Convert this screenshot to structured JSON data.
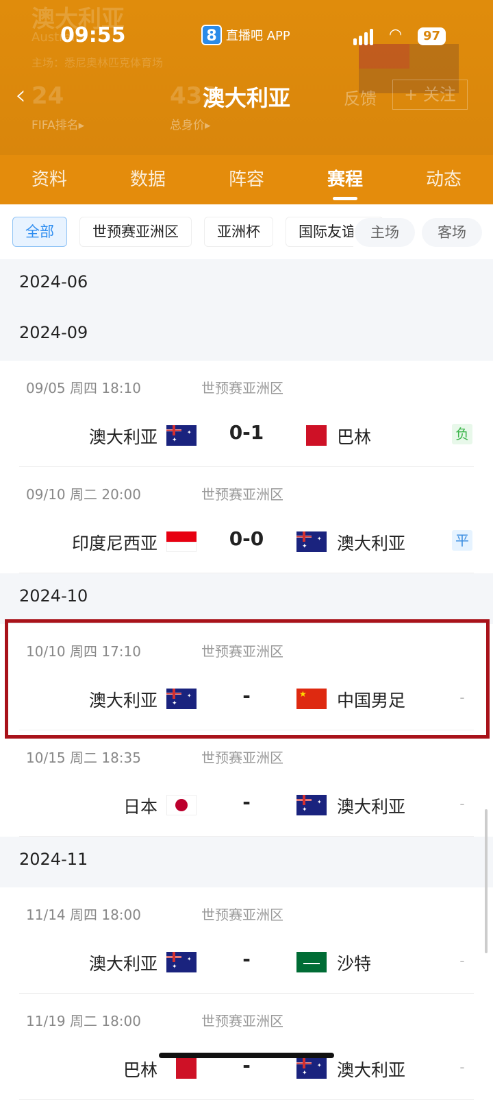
{
  "status_bar": {
    "time": "09:55",
    "app_name": "直播吧 APP",
    "app_logo": "8",
    "battery": "97"
  },
  "header_bg": {
    "team_name": "澳大利亚",
    "team_name_en": "Australia",
    "home_stadium": "主场：悉尼奥林匹克体育场",
    "fifa_rank": "24",
    "fifa_rank_label": "FIFA排名▸",
    "total_value": "432",
    "total_value_label": "总身价▸"
  },
  "nav": {
    "title": "澳大利亚",
    "feedback": "反馈",
    "follow": "+ 关注"
  },
  "tabs": [
    {
      "label": "资料"
    },
    {
      "label": "数据"
    },
    {
      "label": "阵容"
    },
    {
      "label": "赛程",
      "active": true
    },
    {
      "label": "动态"
    }
  ],
  "filters": [
    {
      "label": "全部",
      "active": true
    },
    {
      "label": "世预赛亚洲区"
    },
    {
      "label": "亚洲杯"
    },
    {
      "label": "国际友谊赛"
    }
  ],
  "venue_filters": [
    {
      "label": "主场"
    },
    {
      "label": "客场"
    }
  ],
  "months": [
    "2024-06",
    "2024-09",
    "2024-10",
    "2024-11"
  ],
  "matches": [
    {
      "date": "09/05  周四 18:10",
      "competition": "世预赛亚洲区",
      "home": "澳大利亚",
      "away": "巴林",
      "score": "0-1",
      "result": "负",
      "home_flag": "australia",
      "away_flag": "bahrain"
    },
    {
      "date": "09/10  周二 20:00",
      "competition": "世预赛亚洲区",
      "home": "印度尼西亚",
      "away": "澳大利亚",
      "score": "0-0",
      "result": "平",
      "home_flag": "indonesia",
      "away_flag": "australia"
    },
    {
      "date": "10/10  周四 17:10",
      "competition": "世预赛亚洲区",
      "home": "澳大利亚",
      "away": "中国男足",
      "score": "-",
      "result": "-",
      "home_flag": "australia",
      "away_flag": "china"
    },
    {
      "date": "10/15  周二 18:35",
      "competition": "世预赛亚洲区",
      "home": "日本",
      "away": "澳大利亚",
      "score": "-",
      "result": "-",
      "home_flag": "japan",
      "away_flag": "australia"
    },
    {
      "date": "11/14  周四 18:00",
      "competition": "世预赛亚洲区",
      "home": "澳大利亚",
      "away": "沙特",
      "score": "-",
      "result": "-",
      "home_flag": "australia",
      "away_flag": "saudi"
    },
    {
      "date": "11/19  周二 18:00",
      "competition": "世预赛亚洲区",
      "home": "巴林",
      "away": "澳大利亚",
      "score": "-",
      "result": "-",
      "home_flag": "bahrain",
      "away_flag": "australia"
    }
  ],
  "colors": {
    "header": "#e08c0c",
    "highlight": "#a8121a",
    "active_filter": "#2c8cf0",
    "lose": "#3bb54a",
    "draw": "#3a8de0"
  }
}
